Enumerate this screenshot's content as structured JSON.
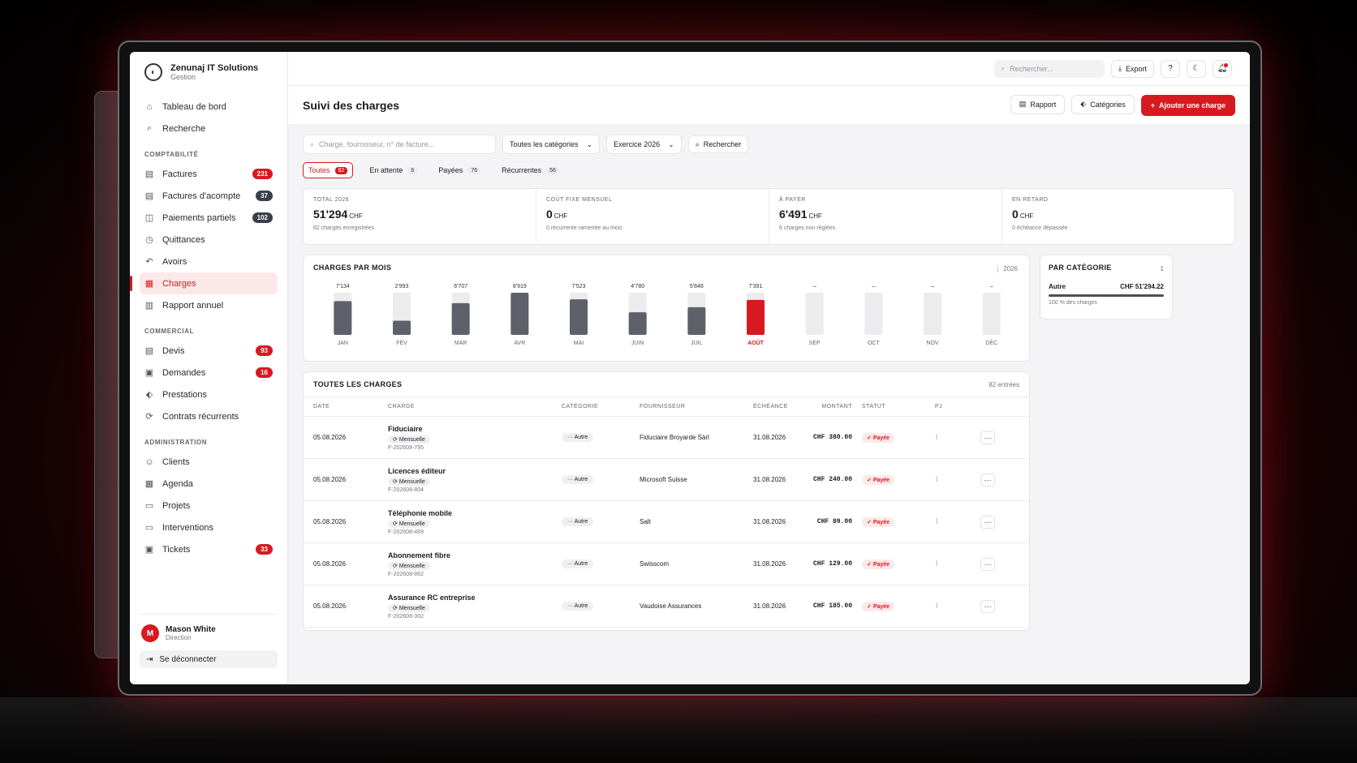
{
  "brand": {
    "name": "Zenunaj IT Solutions",
    "sub": "Gestion"
  },
  "nav": {
    "top": [
      {
        "label": "Tableau de bord",
        "icon": "home-icon",
        "glyph": "⌂"
      },
      {
        "label": "Recherche",
        "icon": "search-icon",
        "glyph": "⌕"
      }
    ],
    "sections": [
      {
        "title": "COMPTABILITÉ",
        "items": [
          {
            "label": "Factures",
            "icon": "invoice-icon",
            "glyph": "▤",
            "badge": "231",
            "badge_dark": false
          },
          {
            "label": "Factures d'acompte",
            "icon": "deposit-invoice-icon",
            "glyph": "▤",
            "badge": "37",
            "badge_dark": true
          },
          {
            "label": "Paiements partiels",
            "icon": "partial-payment-icon",
            "glyph": "◫",
            "badge": "102",
            "badge_dark": true
          },
          {
            "label": "Quittances",
            "icon": "receipt-icon",
            "glyph": "◷",
            "badge": "",
            "badge_dark": false
          },
          {
            "label": "Avoirs",
            "icon": "credit-note-icon",
            "glyph": "↶",
            "badge": "",
            "badge_dark": false
          },
          {
            "label": "Charges",
            "icon": "charges-icon",
            "glyph": "▦",
            "badge": "",
            "badge_dark": false,
            "active": true
          },
          {
            "label": "Rapport annuel",
            "icon": "annual-report-icon",
            "glyph": "▥",
            "badge": "",
            "badge_dark": false
          }
        ]
      },
      {
        "title": "COMMERCIAL",
        "items": [
          {
            "label": "Devis",
            "icon": "quote-icon",
            "glyph": "▤",
            "badge": "93",
            "badge_dark": false
          },
          {
            "label": "Demandes",
            "icon": "requests-icon",
            "glyph": "▣",
            "badge": "16",
            "badge_dark": false
          },
          {
            "label": "Prestations",
            "icon": "tag-icon",
            "glyph": "⬖",
            "badge": "",
            "badge_dark": false
          },
          {
            "label": "Contrats récurrents",
            "icon": "recurring-icon",
            "glyph": "⟳",
            "badge": "",
            "badge_dark": false
          }
        ]
      },
      {
        "title": "ADMINISTRATION",
        "items": [
          {
            "label": "Clients",
            "icon": "clients-icon",
            "glyph": "☺",
            "badge": "",
            "badge_dark": false
          },
          {
            "label": "Agenda",
            "icon": "calendar-icon",
            "glyph": "▦",
            "badge": "",
            "badge_dark": false
          },
          {
            "label": "Projets",
            "icon": "folder-icon",
            "glyph": "▭",
            "badge": "",
            "badge_dark": false
          },
          {
            "label": "Interventions",
            "icon": "intervention-icon",
            "glyph": "▭",
            "badge": "",
            "badge_dark": false
          },
          {
            "label": "Tickets",
            "icon": "ticket-icon",
            "glyph": "▣",
            "badge": "33",
            "badge_dark": false
          }
        ]
      }
    ]
  },
  "user": {
    "initial": "M",
    "name": "Mason White",
    "role": "Direction",
    "logout": "Se déconnecter"
  },
  "topbar": {
    "search_placeholder": "Rechercher...",
    "export": "Export"
  },
  "page": {
    "title": "Suivi des charges",
    "rapport": "Rapport",
    "categories": "Catégories",
    "add": "Ajouter une charge"
  },
  "filters": {
    "search_placeholder": "Charge, fournisseur, n° de facture...",
    "category": "Toutes les catégories",
    "year": "Exercice 2026",
    "search_btn": "Rechercher"
  },
  "tabs": [
    {
      "label": "Toutes",
      "count": "82",
      "active": true
    },
    {
      "label": "En attente",
      "count": "6",
      "active": false
    },
    {
      "label": "Payées",
      "count": "76",
      "active": false
    },
    {
      "label": "Récurrentes",
      "count": "56",
      "active": false
    }
  ],
  "stats": [
    {
      "label": "TOTAL 2026",
      "value": "51'294",
      "unit": "CHF",
      "sub": "82 charges enregistrées"
    },
    {
      "label": "COÛT FIXE MENSUEL",
      "value": "0",
      "unit": "CHF",
      "sub": "0 récurrente ramenée au mois"
    },
    {
      "label": "À PAYER",
      "value": "6'491",
      "unit": "CHF",
      "sub": "6 charges non réglées"
    },
    {
      "label": "EN RETARD",
      "value": "0",
      "unit": "CHF",
      "sub": "0 échéance dépassée"
    }
  ],
  "chart_data": {
    "type": "bar",
    "title": "CHARGES PAR MOIS",
    "year": "2026",
    "categories": [
      "JAN",
      "FÉV",
      "MAR",
      "AVR",
      "MAI",
      "JUIN",
      "JUIL",
      "AOÛT",
      "SEP",
      "OCT",
      "NOV",
      "DÉC"
    ],
    "values": [
      7134,
      2993,
      6707,
      8919,
      7523,
      4780,
      5848,
      7391,
      null,
      null,
      null,
      null
    ],
    "labels": [
      "7'134",
      "2'993",
      "6'707",
      "8'919",
      "7'523",
      "4'780",
      "5'848",
      "7'391",
      "–",
      "–",
      "–",
      "–"
    ],
    "highlight_index": 7,
    "ylim": [
      0,
      8919
    ],
    "colors": {
      "bar": "#5e6169",
      "highlight": "#d71920",
      "track": "#ececee"
    }
  },
  "by_category": {
    "title": "PAR CATÉGORIE",
    "count": "1",
    "name": "Autre",
    "amount": "CHF 51'294.22",
    "share": "100 % des charges"
  },
  "table": {
    "title": "TOUTES LES CHARGES",
    "entries": "82 entrées",
    "columns": [
      "DATE",
      "CHARGE",
      "CATÉGORIE",
      "FOURNISSEUR",
      "ÉCHÉANCE",
      "MONTANT",
      "STATUT",
      "PJ",
      ""
    ],
    "rows": [
      {
        "date": "05.08.2026",
        "name": "Fiduciaire",
        "freq": "Mensuelle",
        "ref": "F-202608-795",
        "category": "Autre",
        "supplier": "Fiduciaire Broyarde Sàrl",
        "due": "31.08.2026",
        "amount": "CHF 380.00",
        "status": "Payée"
      },
      {
        "date": "05.08.2026",
        "name": "Licences éditeur",
        "freq": "Mensuelle",
        "ref": "F-202608-804",
        "category": "Autre",
        "supplier": "Microsoft Suisse",
        "due": "31.08.2026",
        "amount": "CHF 240.00",
        "status": "Payée"
      },
      {
        "date": "05.08.2026",
        "name": "Téléphonie mobile",
        "freq": "Mensuelle",
        "ref": "F-202608-469",
        "category": "Autre",
        "supplier": "Salt",
        "due": "31.08.2026",
        "amount": "CHF 89.00",
        "status": "Payée"
      },
      {
        "date": "05.08.2026",
        "name": "Abonnement fibre",
        "freq": "Mensuelle",
        "ref": "F-202608-862",
        "category": "Autre",
        "supplier": "Swisscom",
        "due": "31.08.2026",
        "amount": "CHF 129.00",
        "status": "Payée"
      },
      {
        "date": "05.08.2026",
        "name": "Assurance RC entreprise",
        "freq": "Mensuelle",
        "ref": "F-202608-302",
        "category": "Autre",
        "supplier": "Vaudoise Assurances",
        "due": "31.08.2026",
        "amount": "CHF 185.00",
        "status": "Payée"
      }
    ]
  }
}
